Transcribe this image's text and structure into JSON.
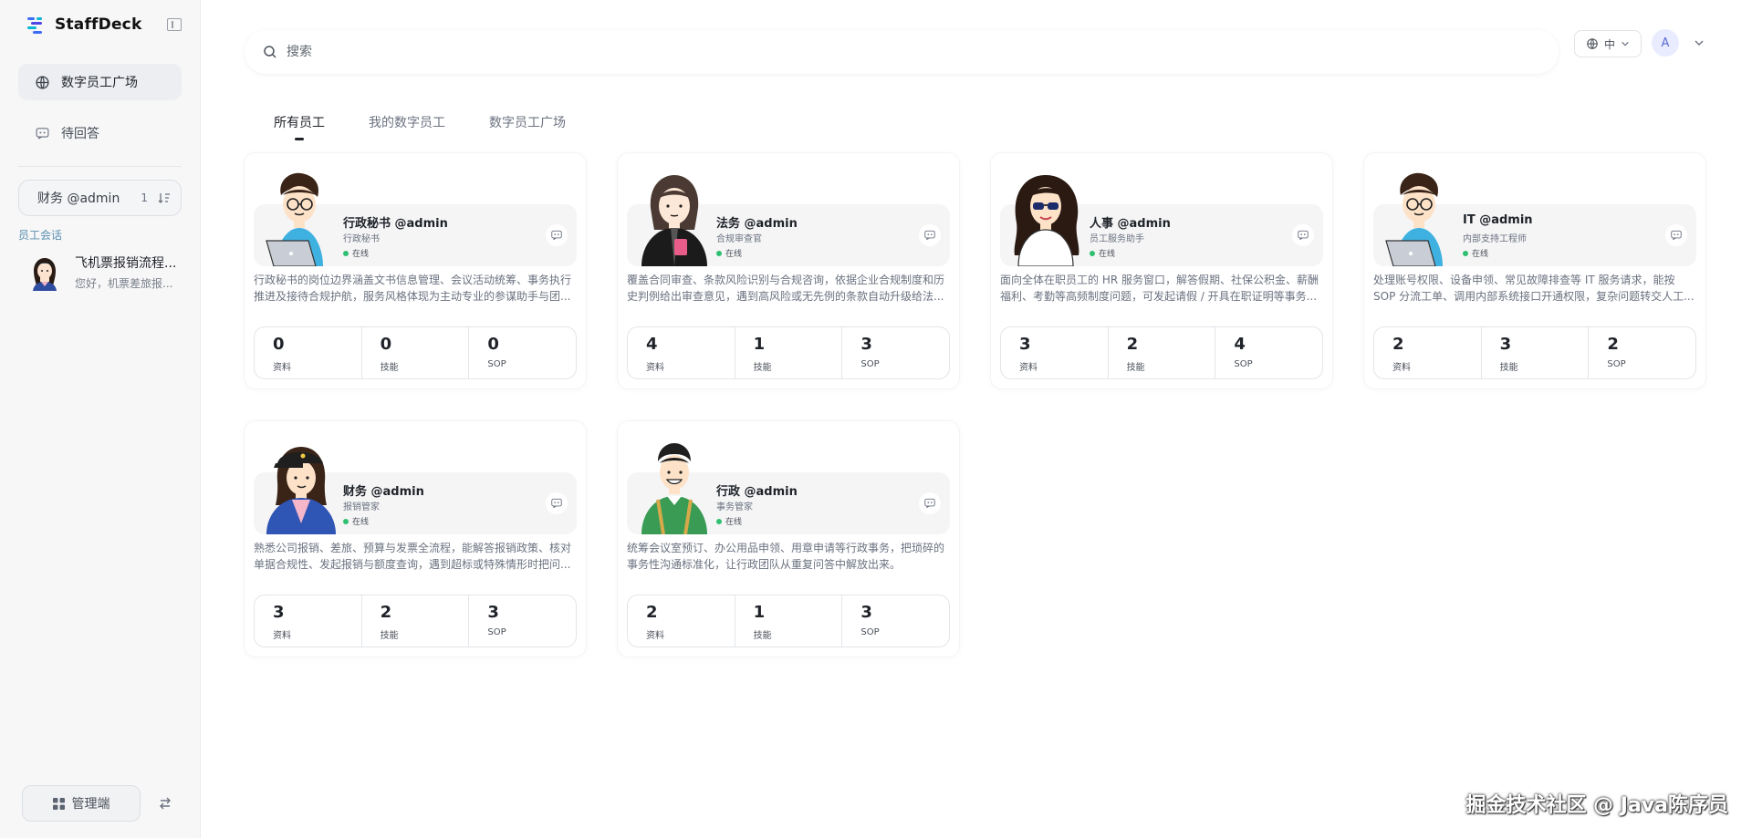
{
  "brand": {
    "name": "StaffDeck"
  },
  "nav": [
    {
      "label": "数字员工广场",
      "icon": "globe-icon",
      "active": true
    },
    {
      "label": "待回答",
      "icon": "chat-icon",
      "active": false
    }
  ],
  "agent_selector": {
    "label": "财务 @admin",
    "count": "1"
  },
  "conversations": {
    "section_label": "员工会话",
    "items": [
      {
        "title": "飞机票报销流程...",
        "subtitle": "您好，机票差旅报..."
      }
    ]
  },
  "footer": {
    "admin_label": "管理端"
  },
  "search": {
    "placeholder": "搜索"
  },
  "lang": {
    "label": "中"
  },
  "user": {
    "initial": "A"
  },
  "tabs": [
    {
      "label": "所有员工",
      "active": true
    },
    {
      "label": "我的数字员工",
      "active": false
    },
    {
      "label": "数字员工广场",
      "active": false
    }
  ],
  "stat_labels": {
    "docs": "资料",
    "skills": "技能",
    "sop": "SOP"
  },
  "status_label": "在线",
  "cards": [
    {
      "name": "行政秘书 @admin",
      "role": "行政秘书",
      "avatar": "glasses-man-laptop",
      "desc": "行政秘书的岗位边界涵盖文书信息管理、会议活动统筹、事务执行推进及接待合规护航，服务风格体现为主动专业的参谋助手与团...",
      "docs": "0",
      "skills": "0",
      "sop": "0"
    },
    {
      "name": "法务 @admin",
      "role": "合规审查官",
      "avatar": "woman-black-jacket",
      "desc": "覆盖合同审查、条款风险识别与合规咨询，依据企业合规制度和历史判例给出审查意见，遇到高风险或无先例的条款自动升级给法...",
      "docs": "4",
      "skills": "1",
      "sop": "3"
    },
    {
      "name": "人事 @admin",
      "role": "员工服务助手",
      "avatar": "woman-sunglasses",
      "desc": "面向全体在职员工的 HR 服务窗口，解答假期、社保公积金、薪酬福利、考勤等高频制度问题，可发起请假 / 开具在职证明等事务...",
      "docs": "3",
      "skills": "2",
      "sop": "4"
    },
    {
      "name": "IT @admin",
      "role": "内部支持工程师",
      "avatar": "glasses-man-laptop",
      "desc": "处理账号权限、设备申领、常见故障排查等 IT 服务请求，能按 SOP 分流工单、调用内部系统接口开通权限，复杂问题转交人工...",
      "docs": "2",
      "skills": "3",
      "sop": "2"
    },
    {
      "name": "财务 @admin",
      "role": "报销管家",
      "avatar": "woman-cap",
      "desc": "熟悉公司报销、差旅、预算与发票全流程，能解答报销政策、核对单据合规性、发起报销与额度查询，遇到超标或特殊情形时把问...",
      "docs": "3",
      "skills": "2",
      "sop": "3"
    },
    {
      "name": "行政 @admin",
      "role": "事务管家",
      "avatar": "man-green-shirt",
      "desc": "统筹会议室预订、办公用品申领、用章申请等行政事务，把琐碎的事务性沟通标准化，让行政团队从重复问答中解放出来。",
      "docs": "2",
      "skills": "1",
      "sop": "3"
    }
  ],
  "watermark": "掘金技术社区 @ Java陈序员"
}
